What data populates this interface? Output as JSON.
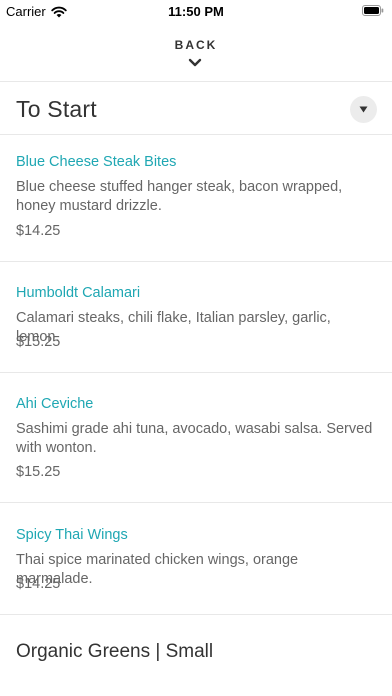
{
  "status_bar": {
    "carrier": "Carrier",
    "time": "11:50 PM"
  },
  "header": {
    "back_label": "BACK"
  },
  "section": {
    "title": "To Start"
  },
  "items": [
    {
      "name": "Blue Cheese Steak Bites",
      "description": "Blue cheese stuffed hanger steak, bacon wrapped, honey mustard drizzle.",
      "price": "$14.25"
    },
    {
      "name": "Humboldt Calamari",
      "description": "Calamari steaks, chili flake, Italian parsley, garlic, lemon.",
      "price": "$15.25"
    },
    {
      "name": "Ahi Ceviche",
      "description": "Sashimi grade ahi tuna, avocado, wasabi salsa. Served with wonton.",
      "price": "$15.25"
    },
    {
      "name": "Spicy Thai Wings",
      "description": "Thai spice marinated chicken wings, orange marmalade.",
      "price": "$14.25"
    }
  ],
  "next_section": {
    "title": "Organic Greens | Small"
  },
  "colors": {
    "accent": "#1fa7b3",
    "text": "#333333",
    "muted": "#666666"
  }
}
